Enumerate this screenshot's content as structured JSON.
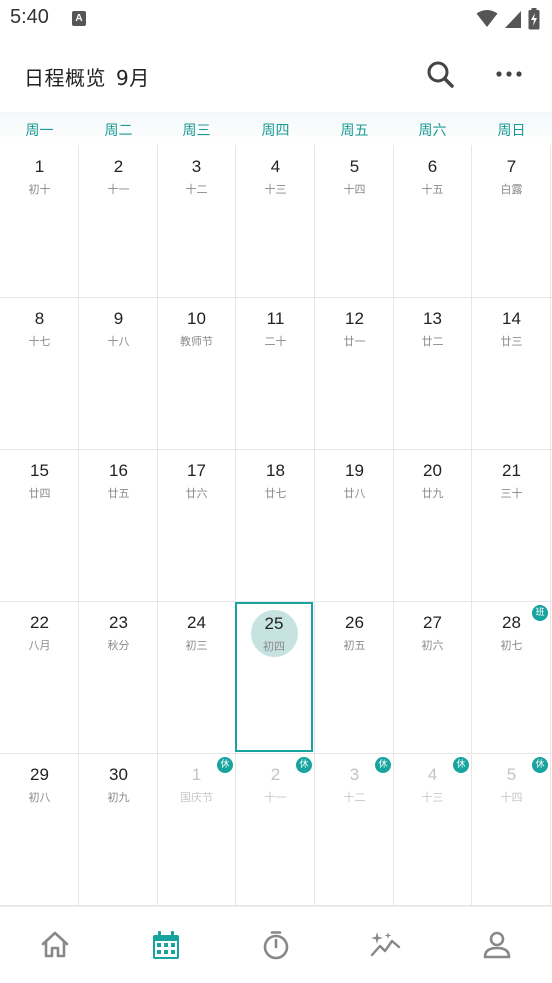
{
  "status": {
    "time": "5:40",
    "notification_glyph": "A",
    "icons": [
      "wifi-icon",
      "signal-icon",
      "battery-charging-icon"
    ]
  },
  "appbar": {
    "title": "日程概览",
    "month": "9月",
    "actions": [
      "search-icon",
      "more-icon"
    ]
  },
  "colors": {
    "accent": "#17a39e",
    "today_fill": "#c7e3e1",
    "muted_text": "#c4c4c4"
  },
  "weekdays": [
    "周一",
    "周二",
    "周三",
    "周四",
    "周五",
    "周六",
    "周日"
  ],
  "weeks": [
    [
      {
        "num": "1",
        "lunar": "初十"
      },
      {
        "num": "2",
        "lunar": "十一"
      },
      {
        "num": "3",
        "lunar": "十二"
      },
      {
        "num": "4",
        "lunar": "十三"
      },
      {
        "num": "5",
        "lunar": "十四"
      },
      {
        "num": "6",
        "lunar": "十五"
      },
      {
        "num": "7",
        "lunar": "白露"
      }
    ],
    [
      {
        "num": "8",
        "lunar": "十七"
      },
      {
        "num": "9",
        "lunar": "十八"
      },
      {
        "num": "10",
        "lunar": "教师节"
      },
      {
        "num": "11",
        "lunar": "二十"
      },
      {
        "num": "12",
        "lunar": "廿一"
      },
      {
        "num": "13",
        "lunar": "廿二"
      },
      {
        "num": "14",
        "lunar": "廿三"
      }
    ],
    [
      {
        "num": "15",
        "lunar": "廿四"
      },
      {
        "num": "16",
        "lunar": "廿五"
      },
      {
        "num": "17",
        "lunar": "廿六"
      },
      {
        "num": "18",
        "lunar": "廿七"
      },
      {
        "num": "19",
        "lunar": "廿八"
      },
      {
        "num": "20",
        "lunar": "廿九"
      },
      {
        "num": "21",
        "lunar": "三十"
      }
    ],
    [
      {
        "num": "22",
        "lunar": "八月"
      },
      {
        "num": "23",
        "lunar": "秋分"
      },
      {
        "num": "24",
        "lunar": "初三"
      },
      {
        "num": "25",
        "lunar": "初四",
        "today": true
      },
      {
        "num": "26",
        "lunar": "初五"
      },
      {
        "num": "27",
        "lunar": "初六"
      },
      {
        "num": "28",
        "lunar": "初七",
        "badge": "班"
      }
    ],
    [
      {
        "num": "29",
        "lunar": "初八"
      },
      {
        "num": "30",
        "lunar": "初九"
      },
      {
        "num": "1",
        "lunar": "国庆节",
        "muted": true,
        "badge": "休"
      },
      {
        "num": "2",
        "lunar": "十一",
        "muted": true,
        "badge": "休"
      },
      {
        "num": "3",
        "lunar": "十二",
        "muted": true,
        "badge": "休"
      },
      {
        "num": "4",
        "lunar": "十三",
        "muted": true,
        "badge": "休"
      },
      {
        "num": "5",
        "lunar": "十四",
        "muted": true,
        "badge": "休"
      }
    ]
  ],
  "bottom_nav": [
    {
      "icon": "home-icon",
      "active": false
    },
    {
      "icon": "calendar-icon",
      "active": true
    },
    {
      "icon": "timer-icon",
      "active": false
    },
    {
      "icon": "sparkle-chart-icon",
      "active": false
    },
    {
      "icon": "profile-icon",
      "active": false
    }
  ]
}
